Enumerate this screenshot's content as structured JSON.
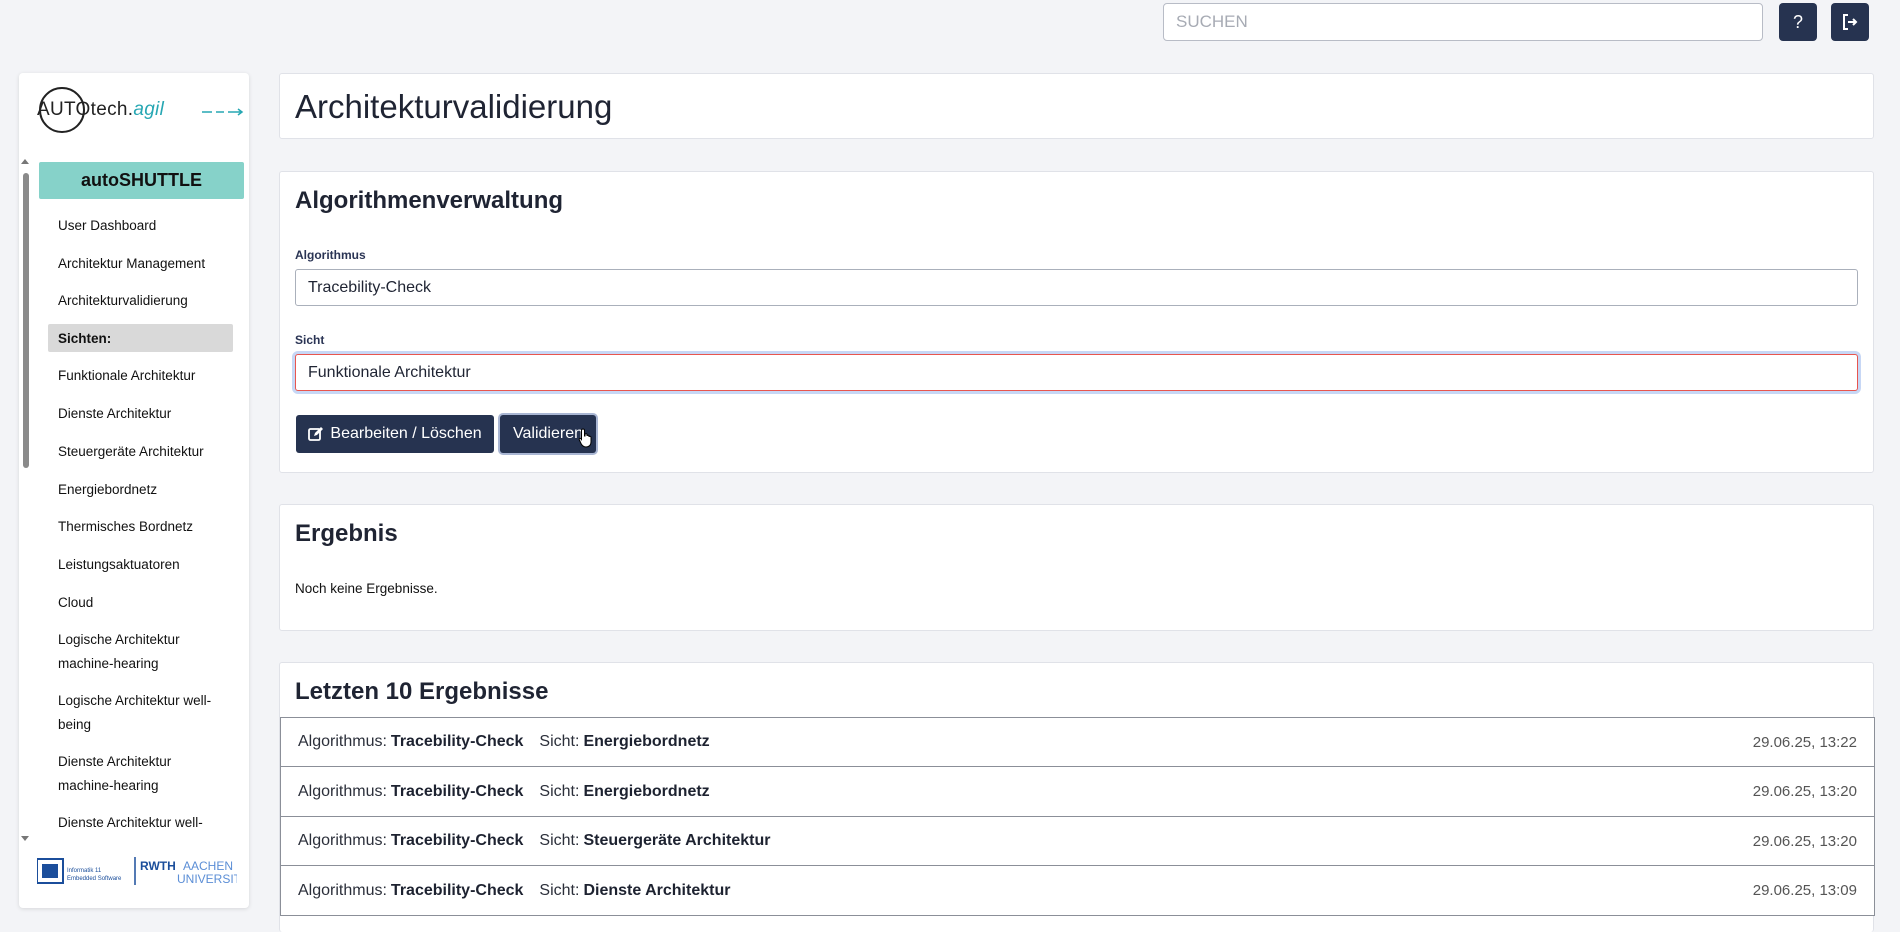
{
  "topbar": {
    "search_placeholder": "SUCHEN",
    "help_label": "?",
    "logout_icon": "logout-icon"
  },
  "sidebar": {
    "logo": {
      "main": "AUTOtech.",
      "accent": "agil"
    },
    "project": "autoSHUTTLE",
    "items": [
      {
        "label": "User Dashboard"
      },
      {
        "label": "Architektur Management"
      },
      {
        "label": "Architekturvalidierung"
      }
    ],
    "views_header": "Sichten:",
    "views": [
      {
        "label": "Funktionale Architektur"
      },
      {
        "label": "Dienste Architektur"
      },
      {
        "label": "Steuergeräte Architektur"
      },
      {
        "label": "Energiebordnetz"
      },
      {
        "label": "Thermisches Bordnetz"
      },
      {
        "label": "Leistungsaktuatoren"
      },
      {
        "label": "Cloud"
      },
      {
        "label": "Logische Architektur machine-hearing"
      },
      {
        "label": "Logische Architektur well-being"
      },
      {
        "label": "Dienste Architektur machine-hearing"
      },
      {
        "label": "Dienste Architektur well-being"
      }
    ],
    "footer_logos": {
      "left": "Informatik 11 Embedded Software",
      "right": "RWTH AACHEN UNIVERSITY"
    }
  },
  "page": {
    "title": "Architekturvalidierung"
  },
  "algorithm_section": {
    "title": "Algorithmenverwaltung",
    "algorithm_label": "Algorithmus",
    "algorithm_value": "Tracebility-Check",
    "view_label": "Sicht",
    "view_value": "Funktionale Architektur",
    "edit_button": "Bearbeiten / Löschen",
    "validate_button": "Validieren"
  },
  "result_section": {
    "title": "Ergebnis",
    "empty_text": "Noch keine Ergebnisse."
  },
  "last_results": {
    "title": "Letzten 10 Ergebnisse",
    "algorithm_key": "Algorithmus:",
    "view_key": "Sicht:",
    "rows": [
      {
        "algorithm": "Tracebility-Check",
        "view": "Energiebordnetz",
        "date": "29.06.25, 13:22"
      },
      {
        "algorithm": "Tracebility-Check",
        "view": "Energiebordnetz",
        "date": "29.06.25, 13:20"
      },
      {
        "algorithm": "Tracebility-Check",
        "view": "Steuergeräte Architektur",
        "date": "29.06.25, 13:20"
      },
      {
        "algorithm": "Tracebility-Check",
        "view": "Dienste Architektur",
        "date": "29.06.25, 13:09"
      }
    ]
  }
}
